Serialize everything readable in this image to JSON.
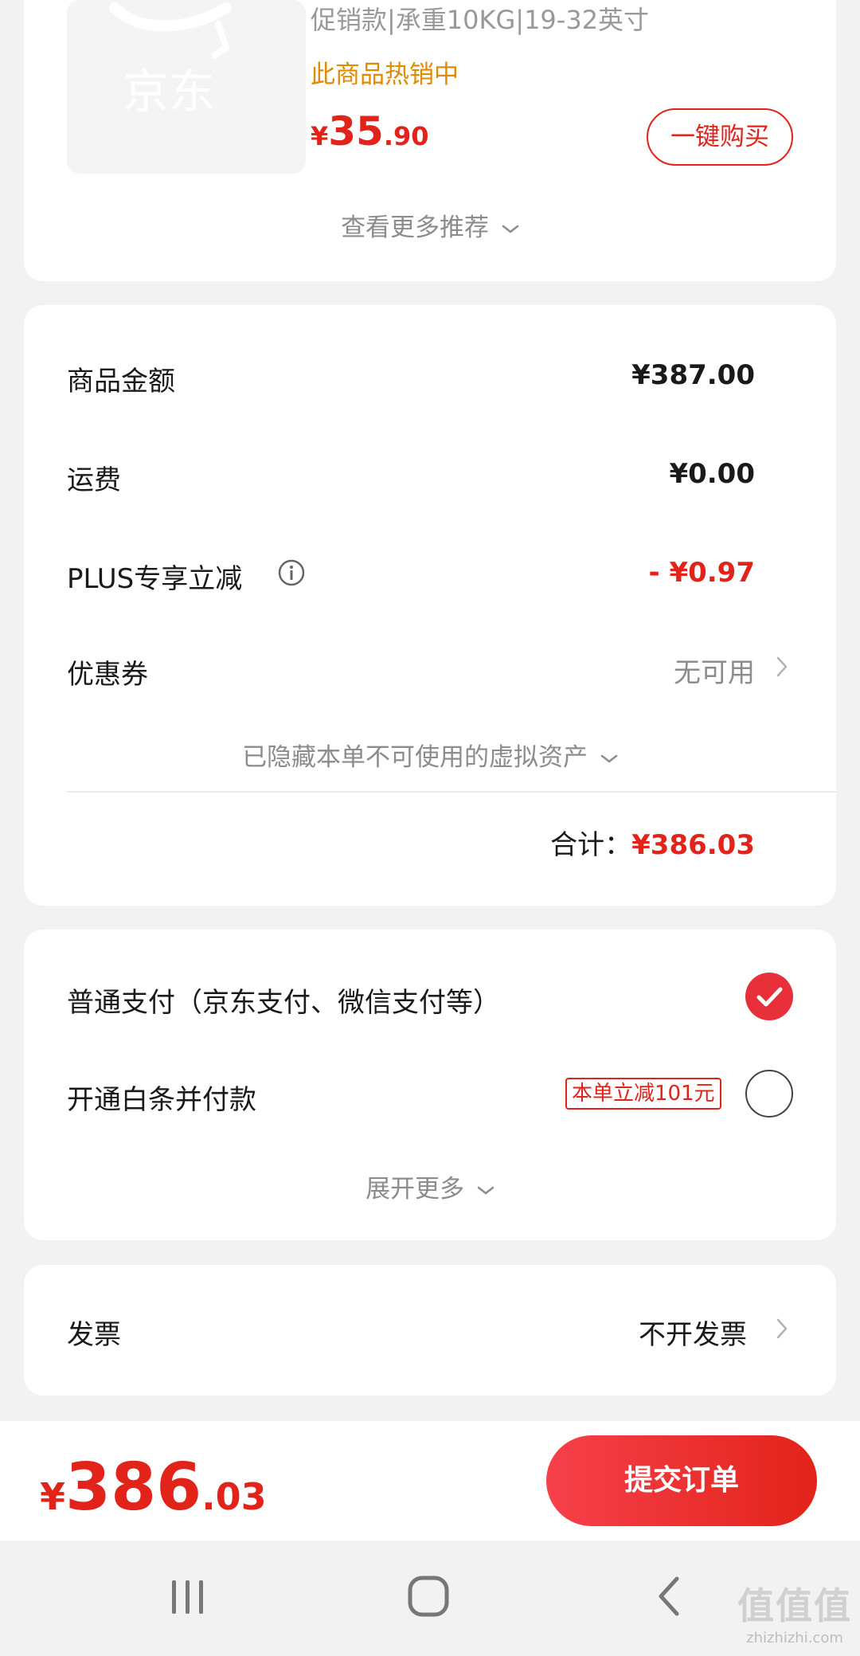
{
  "recommend": {
    "product_title": "促销款|承重10KG|19-32英寸",
    "hot_text": "此商品热销中",
    "price_currency": "¥",
    "price_int": "35",
    "price_dec": ".90",
    "buy_button": "一键购买",
    "more_label": "查看更多推荐",
    "thumb_logo": "京东"
  },
  "summary": {
    "goods_amount_label": "商品金额",
    "goods_amount_value": "¥387.00",
    "shipping_label": "运费",
    "shipping_value": "¥0.00",
    "plus_label": "PLUS专享立减",
    "plus_value": "- ¥0.97",
    "coupon_label": "优惠券",
    "coupon_value": "无可用",
    "hidden_assets": "已隐藏本单不可使用的虚拟资产",
    "total_label": "合计：",
    "total_value": "¥386.03"
  },
  "payment": {
    "normal_label": "普通支付（京东支付、微信支付等）",
    "baitiao_label": "开通白条并付款",
    "baitiao_promo": "本单立减101元",
    "expand_more": "展开更多"
  },
  "invoice": {
    "label": "发票",
    "value": "不开发票"
  },
  "bottom": {
    "currency": "¥",
    "price_int": "386",
    "price_dec": ".03",
    "submit": "提交订单"
  },
  "watermark": {
    "text": "值值值",
    "url": "zhizhizhi.com"
  },
  "colors": {
    "accent": "#e2231a",
    "hot": "#e08a00",
    "muted": "#8c8c8c",
    "background": "#f2f2f2"
  }
}
